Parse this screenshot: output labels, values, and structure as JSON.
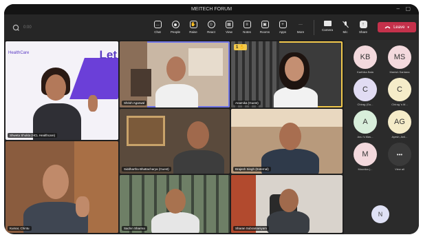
{
  "window": {
    "title": "MEITECH FORUM",
    "minimize": "–",
    "maximize": "▢"
  },
  "toolbar": {
    "meeting_time": "0:00",
    "buttons": [
      {
        "label": "Chat",
        "icon": "chat-icon"
      },
      {
        "label": "People",
        "icon": "people-icon"
      },
      {
        "label": "Raise",
        "icon": "raise-hand-icon"
      },
      {
        "label": "React",
        "icon": "react-icon"
      },
      {
        "label": "View",
        "icon": "view-icon"
      },
      {
        "label": "Notes",
        "icon": "notes-icon"
      },
      {
        "label": "Rooms",
        "icon": "rooms-icon"
      },
      {
        "label": "Apps",
        "icon": "apps-icon"
      },
      {
        "label": "More",
        "icon": "more-icon"
      }
    ],
    "media": [
      {
        "label": "Camera",
        "icon": "camera-icon"
      },
      {
        "label": "Mic",
        "icon": "mic-off-icon"
      },
      {
        "label": "Share",
        "icon": "share-icon"
      }
    ],
    "leave_label": "Leave",
    "leave_color": "#c4314b"
  },
  "tiles": [
    {
      "name": "Shweta Shukla (HCL Healthcare)",
      "brand_text": "Let",
      "brand_sub": "HealthCare"
    },
    {
      "name": "Shrish Agarwal"
    },
    {
      "name": "Anamika (Guest)",
      "hand_count": "1"
    },
    {
      "name": "Siddhartha Bhattacharya (Guest)"
    },
    {
      "name": "Brajesh Singh (External)"
    },
    {
      "name": "Kumar, Chintu"
    },
    {
      "name": "Sachin Sharma"
    },
    {
      "name": "Sharan Subramaniyam"
    }
  ],
  "participants": [
    {
      "initials": "KB",
      "name": "Karthika Bala",
      "color": "#f3d9dd"
    },
    {
      "initials": "MS",
      "name": "Manish Santana",
      "color": "#f3d9dd"
    },
    {
      "initials": "C",
      "name": "Chirag (Gu...",
      "color": "#e1dcf3"
    },
    {
      "initials": "C",
      "name": "Chirag 's M...",
      "color": "#f5ecc9"
    },
    {
      "initials": "A",
      "name": "Anu 's Mas...",
      "color": "#d8eedb"
    },
    {
      "initials": "AG",
      "name": "Ayesh, Anil...",
      "color": "#f5ecc9"
    },
    {
      "initials": "M",
      "name": "Mounika (...",
      "color": "#f3d9dd"
    },
    {
      "initials": "•••",
      "name": "View all",
      "color": "#3a3a3a"
    }
  ],
  "bottom_participant": {
    "initials": "N"
  }
}
